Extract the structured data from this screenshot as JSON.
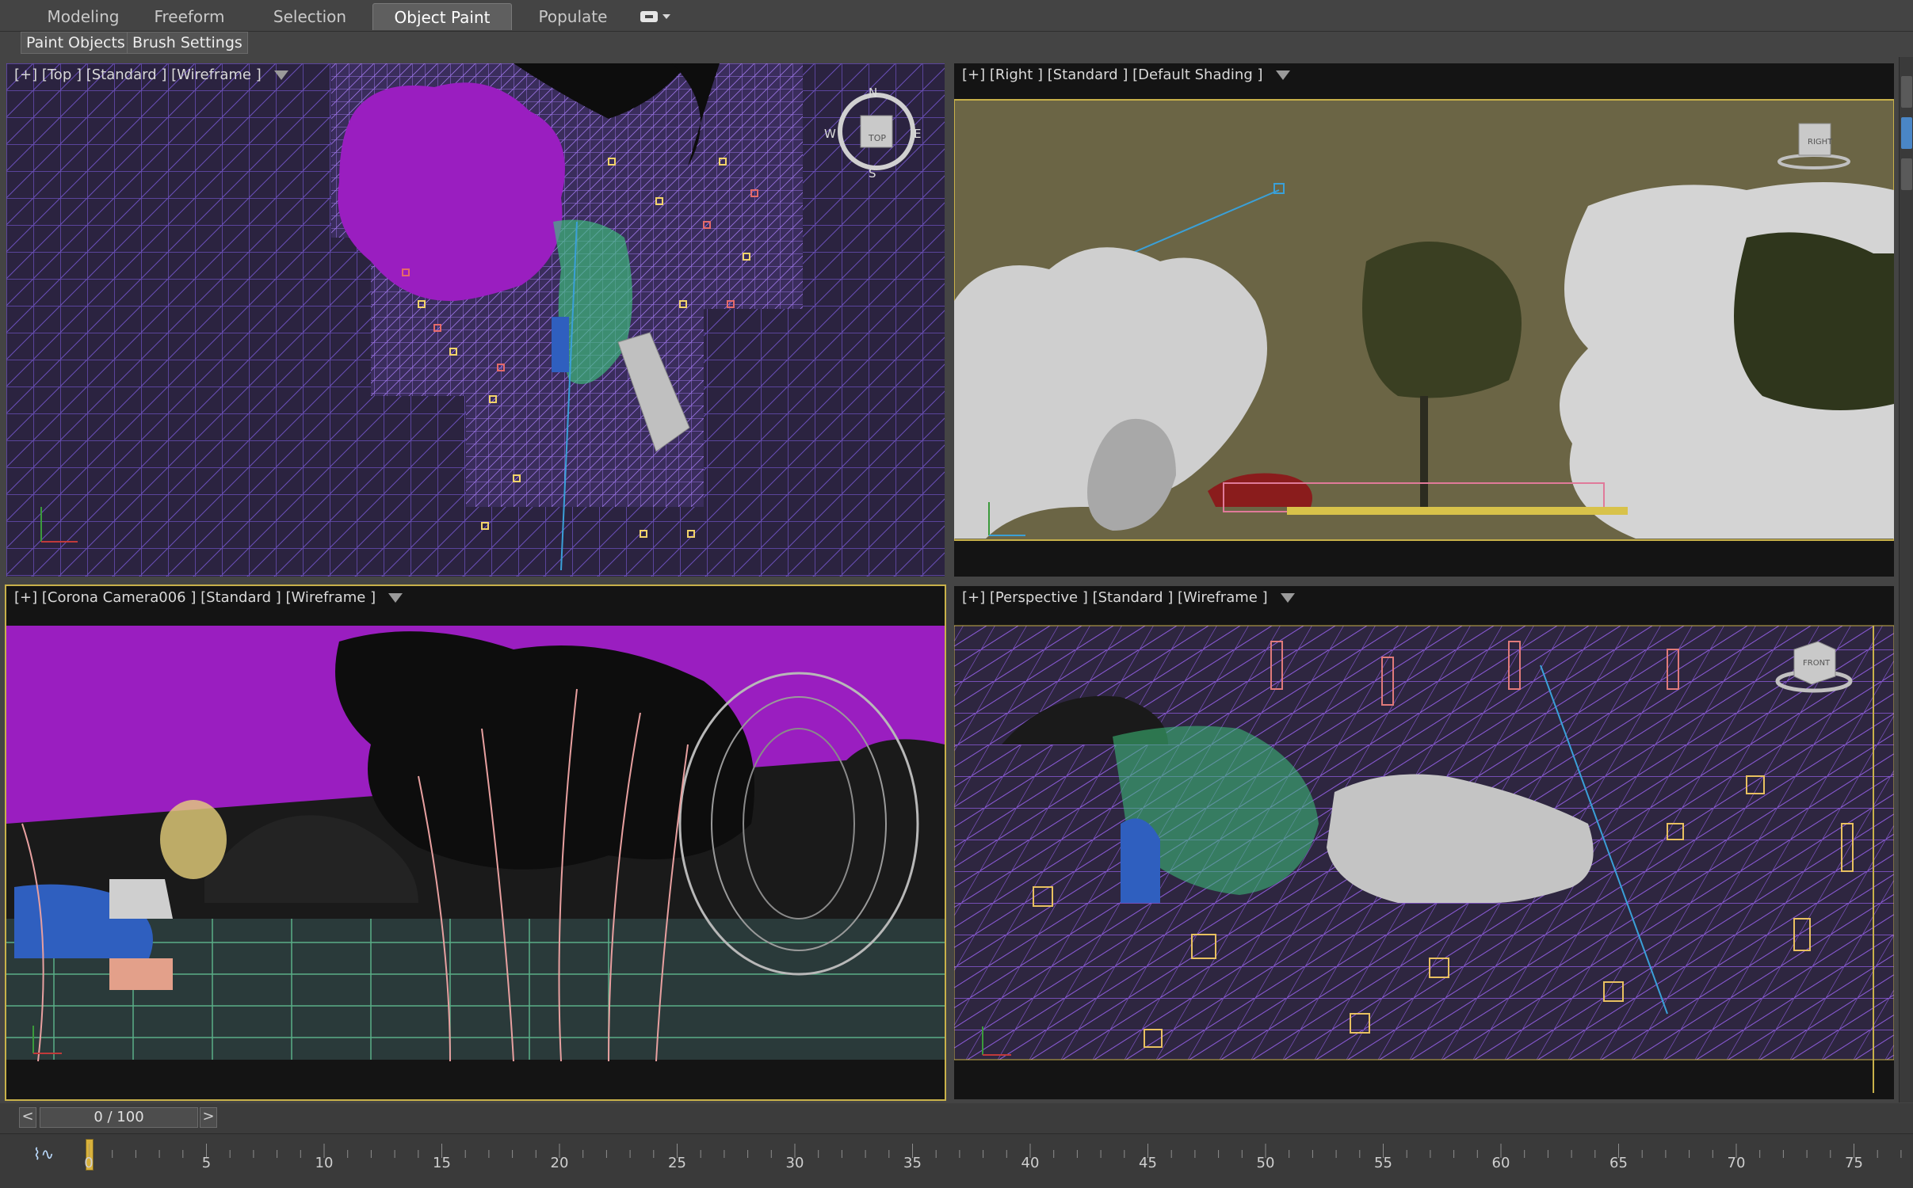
{
  "ribbon": {
    "tabs": [
      {
        "label": "Modeling",
        "active": false
      },
      {
        "label": "Freeform",
        "active": false
      },
      {
        "label": "Selection",
        "active": false
      },
      {
        "label": "Object Paint",
        "active": true
      },
      {
        "label": "Populate",
        "active": false
      }
    ],
    "panel_buttons": [
      "Paint Objects",
      "Brush Settings"
    ]
  },
  "viewports": {
    "top": {
      "label": "[+] [Top ] [Standard ] [Wireframe ]",
      "viewcube": "TOP",
      "compass": [
        "N",
        "E",
        "S",
        "W"
      ]
    },
    "right": {
      "label": "[+] [Right ] [Standard ] [Default Shading ]",
      "viewcube": "RIGHT"
    },
    "camera": {
      "label": "[+] [Corona Camera006 ] [Standard ] [Wireframe ]",
      "active": true
    },
    "perspective": {
      "label": "[+] [Perspective ] [Standard ] [Wireframe ]",
      "viewcube": "FRONT"
    }
  },
  "time_slider": {
    "value": "0 / 100",
    "prev_label": "<",
    "next_label": ">",
    "current_frame": 0,
    "total_frames": 100
  },
  "timeline": {
    "ticks": [
      "0",
      "5",
      "10",
      "15",
      "20",
      "25",
      "30",
      "35",
      "40",
      "45",
      "50",
      "55",
      "60",
      "65",
      "70",
      "75"
    ],
    "curve_icon": "curve-editor-icon"
  },
  "colors": {
    "active_border": "#c8b14a",
    "grid_purple": "#8a5ad6",
    "foliage_magenta": "#9a1ec0",
    "right_bg": "#6b6545"
  }
}
